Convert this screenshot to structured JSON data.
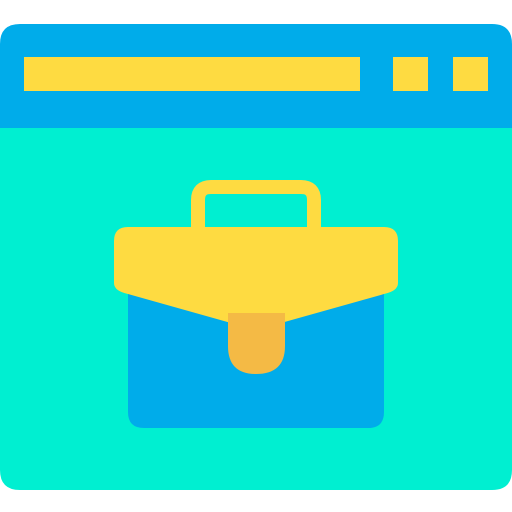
{
  "icon": {
    "name": "browser-briefcase-icon",
    "colors": {
      "window_header": "#00ACEA",
      "window_body": "#00EFD1",
      "address_bar": "#FEDB41",
      "window_buttons": "#FEDB41",
      "briefcase_body": "#00ACEA",
      "briefcase_flap": "#FEDB41",
      "briefcase_handle": "#FEDB41",
      "briefcase_clasp": "#F4BA45"
    }
  }
}
